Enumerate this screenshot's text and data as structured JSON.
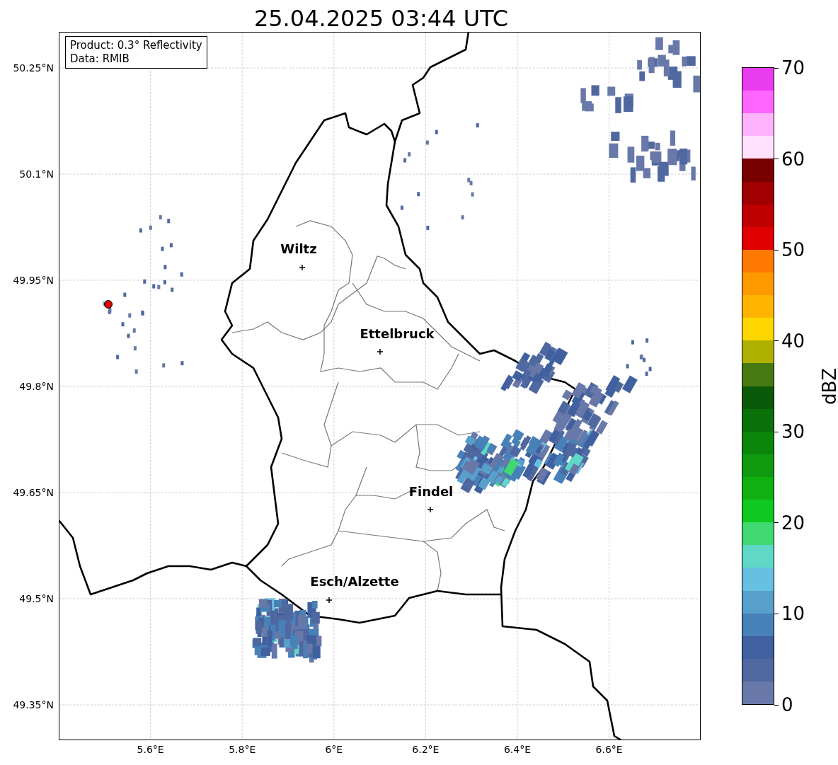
{
  "title": "25.04.2025 03:44 UTC",
  "legend": {
    "lines": [
      "Product: 0.3° Reflectivity",
      "Data: RMIB"
    ]
  },
  "axes": {
    "yticks": [
      "50.25°N",
      "50.1°N",
      "49.95°N",
      "49.8°N",
      "49.65°N",
      "49.5°N",
      "49.35°N"
    ],
    "xticks": [
      "5.6°E",
      "5.8°E",
      "6°E",
      "6.2°E",
      "6.4°E",
      "6.6°E"
    ]
  },
  "cities": [
    {
      "name": "Wiltz"
    },
    {
      "name": "Ettelbruck"
    },
    {
      "name": "Findel"
    },
    {
      "name": "Esch/Alzette"
    }
  ],
  "colorbar": {
    "label": "dBZ",
    "ticks": [
      "70",
      "60",
      "50",
      "40",
      "30",
      "20",
      "10",
      "0"
    ],
    "segments": [
      {
        "color": "#e83cee"
      },
      {
        "color": "#ff66ff"
      },
      {
        "color": "#ffb3ff"
      },
      {
        "color": "#ffe0ff"
      },
      {
        "color": "#780000"
      },
      {
        "color": "#a00000"
      },
      {
        "color": "#c00000"
      },
      {
        "color": "#e00000"
      },
      {
        "color": "#ff7a00"
      },
      {
        "color": "#ff9900"
      },
      {
        "color": "#ffb400"
      },
      {
        "color": "#ffd700"
      },
      {
        "color": "#b0b000"
      },
      {
        "color": "#467a10"
      },
      {
        "color": "#0a5a0a"
      },
      {
        "color": "#0a700a"
      },
      {
        "color": "#0a850a"
      },
      {
        "color": "#0f9a10"
      },
      {
        "color": "#10b010"
      },
      {
        "color": "#10c820"
      },
      {
        "color": "#40d870"
      },
      {
        "color": "#60d8c8"
      },
      {
        "color": "#68c0e0"
      },
      {
        "color": "#58a0cc"
      },
      {
        "color": "#4880b8"
      },
      {
        "color": "#4060a0"
      },
      {
        "color": "#5068a0"
      },
      {
        "color": "#6878a8"
      }
    ]
  }
}
